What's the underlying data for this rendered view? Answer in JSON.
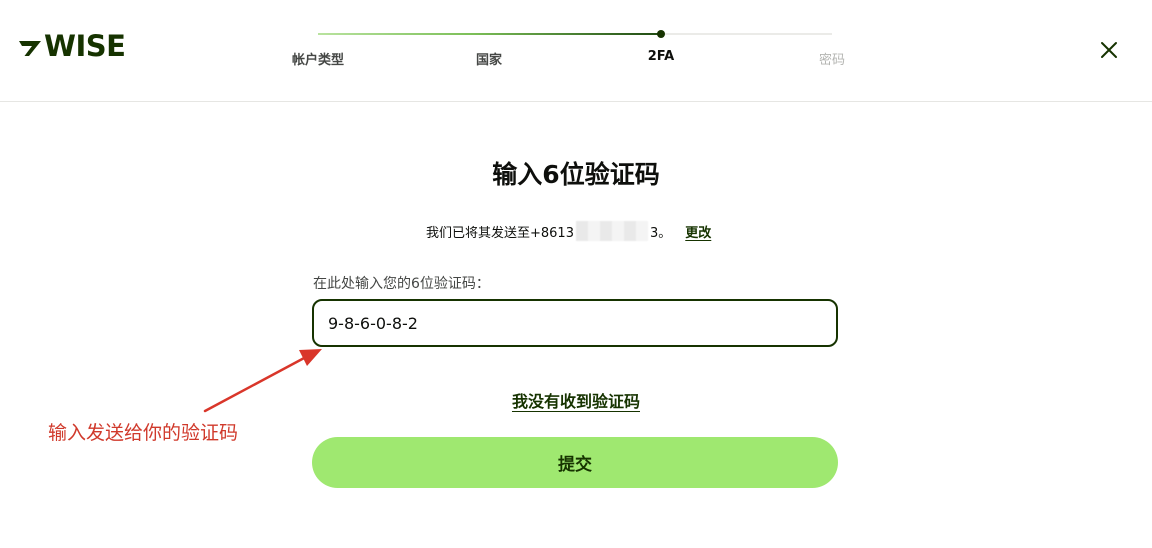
{
  "brand": {
    "logo_text": "WISE",
    "logo_color": "#163300"
  },
  "stepper": {
    "steps": [
      {
        "label": "帐户类型",
        "state": "done"
      },
      {
        "label": "国家",
        "state": "done"
      },
      {
        "label": "2FA",
        "state": "current"
      },
      {
        "label": "密码",
        "state": "upcoming"
      }
    ],
    "progress": 0.667
  },
  "close_icon": "close-icon",
  "main": {
    "title": "输入6位验证码",
    "sent_prefix": "我们已将其发送至+8613",
    "sent_suffix": "3。",
    "change_link": "更改",
    "field_label": "在此处输入您的6位验证码：",
    "code_value": "9-8-6-0-8-2",
    "no_code_link": "我没有收到验证码",
    "submit_label": "提交"
  },
  "annotation": {
    "text": "输入发送给你的验证码",
    "color": "#d0392b"
  },
  "colors": {
    "accent": "#9fe870",
    "forest": "#163300"
  }
}
